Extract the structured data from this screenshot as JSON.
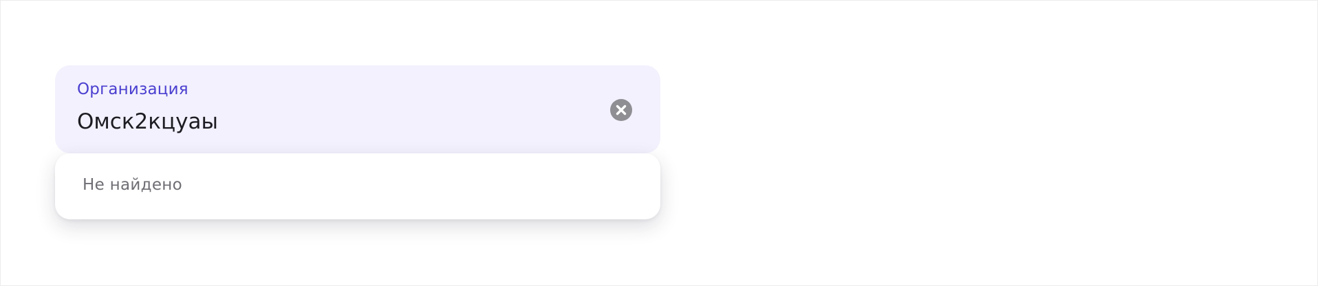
{
  "field": {
    "label": "Организация",
    "value": "Омск2кцуаы",
    "clear_icon": "clear-circle-x-icon"
  },
  "dropdown": {
    "empty_text": "Не найдено"
  },
  "colors": {
    "label_accent": "#4a3fd0",
    "field_background": "#f3f1fd",
    "clear_icon": "#8e8e93"
  }
}
